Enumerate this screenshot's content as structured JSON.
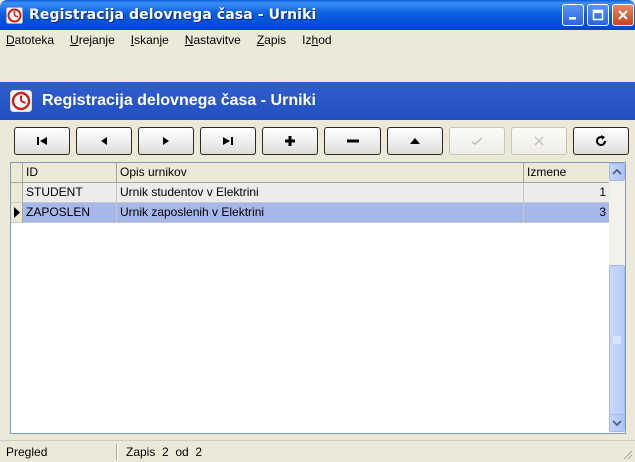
{
  "window": {
    "title": "Registracija delovnega časa - Urniki"
  },
  "menu": {
    "items": [
      {
        "label": "Datoteka",
        "accel": "D",
        "rest": "atoteka"
      },
      {
        "label": "Urejanje",
        "accel": "U",
        "rest": "rejanje"
      },
      {
        "label": "Iskanje",
        "accel": "I",
        "rest": "skanje"
      },
      {
        "label": "Nastavitve",
        "accel": "N",
        "rest": "astavitve"
      },
      {
        "label": "Zapis",
        "accel": "Z",
        "rest": "apis"
      },
      {
        "label": "Izhod",
        "pre": "Iz",
        "accel": "h",
        "rest": "od"
      }
    ]
  },
  "header": {
    "title": "Registracija delovnega časa - Urniki"
  },
  "toolbar": {
    "buttons": [
      {
        "name": "first-record",
        "glyph": "⏮",
        "enabled": true
      },
      {
        "name": "prior-record",
        "glyph": "◀",
        "enabled": true
      },
      {
        "name": "next-record",
        "glyph": "▶",
        "enabled": true
      },
      {
        "name": "last-record",
        "glyph": "⏭",
        "enabled": true
      },
      {
        "name": "insert-record",
        "glyph": "+",
        "enabled": true
      },
      {
        "name": "delete-record",
        "glyph": "−",
        "enabled": true
      },
      {
        "name": "edit-record",
        "glyph": "▲",
        "enabled": true
      },
      {
        "name": "post-edit",
        "glyph": "✓",
        "enabled": false
      },
      {
        "name": "cancel-edit",
        "glyph": "✕",
        "enabled": false
      },
      {
        "name": "refresh-data",
        "glyph": "↻",
        "enabled": true
      }
    ]
  },
  "grid": {
    "columns": [
      "ID",
      "Opis urnikov",
      "Izmene"
    ],
    "rows": [
      {
        "id": "STUDENT",
        "opis": "Urnik studentov v Elektrini",
        "izmene": "1",
        "selected": false
      },
      {
        "id": "ZAPOSLEN",
        "opis": "Urnik zaposlenih v Elektrini",
        "izmene": "3",
        "selected": true
      }
    ]
  },
  "status": {
    "mode": "Pregled",
    "record": "Zapis  2  od  2"
  },
  "colors": {
    "titlebar": "#0a5fe0",
    "header": "#2a57c7",
    "selected_row": "#a6b7ea"
  }
}
